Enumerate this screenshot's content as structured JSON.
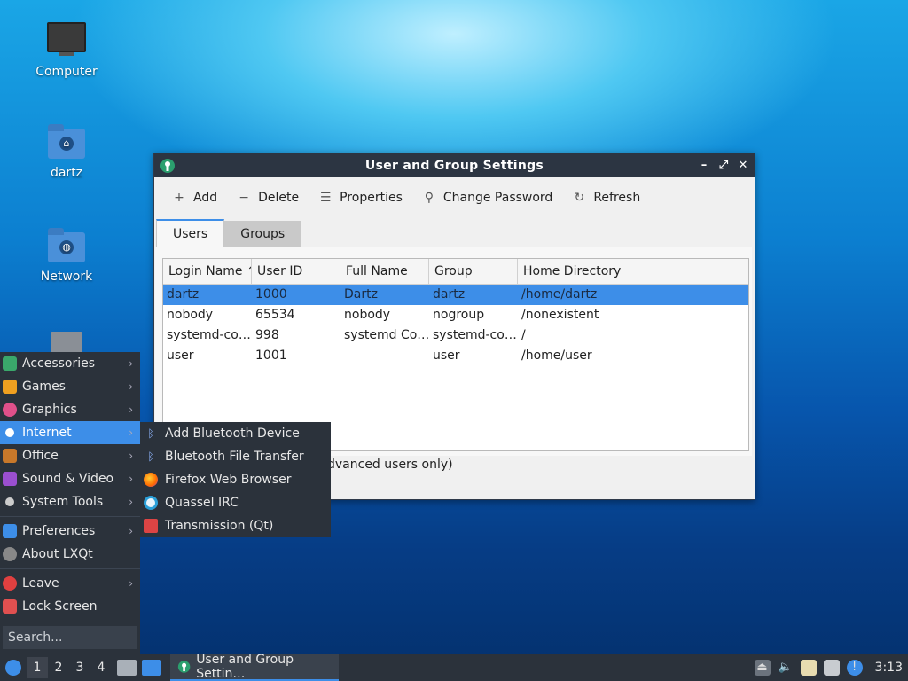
{
  "desktop": {
    "icons": [
      {
        "label": "Computer"
      },
      {
        "label": "dartz"
      },
      {
        "label": "Network"
      }
    ]
  },
  "window": {
    "title": "User and Group Settings",
    "controls": {
      "minimize": "–",
      "maximize": "⤢",
      "close": "✕"
    },
    "toolbar": {
      "add": "Add",
      "delete": "Delete",
      "properties": "Properties",
      "change_password": "Change Password",
      "refresh": "Refresh"
    },
    "tabs": [
      {
        "label": "Users"
      },
      {
        "label": "Groups"
      }
    ],
    "table": {
      "headers": [
        "Login Name",
        "User ID",
        "Full Name",
        "Group",
        "Home Directory"
      ],
      "rows": [
        [
          "dartz",
          "1000",
          "Dartz",
          "dartz",
          "/home/dartz"
        ],
        [
          "nobody",
          "65534",
          "nobody",
          "nogroup",
          "/nonexistent"
        ],
        [
          "systemd-co…",
          "998",
          "systemd Co…",
          "systemd-co…",
          "/"
        ],
        [
          "user",
          "1001",
          "",
          "user",
          "/home/user"
        ]
      ]
    },
    "note": "dvanced users only)"
  },
  "menu": {
    "items": [
      {
        "label": "Accessories",
        "color": "#3aa86b"
      },
      {
        "label": "Games",
        "color": "#f0a020"
      },
      {
        "label": "Graphics",
        "color": "#e0508a"
      },
      {
        "label": "Internet",
        "color": "#3d8ee8"
      },
      {
        "label": "Office",
        "color": "#c8782a"
      },
      {
        "label": "Sound & Video",
        "color": "#9b4fd0"
      },
      {
        "label": "System Tools",
        "color": "#cccccc"
      },
      {
        "label": "Preferences",
        "color": "#3d8ee8"
      },
      {
        "label": "About LXQt",
        "color": "#888888"
      },
      {
        "label": "Leave",
        "color": "#e04040"
      },
      {
        "label": "Lock Screen",
        "color": "#e05050"
      }
    ],
    "search_placeholder": "Search..."
  },
  "submenu": {
    "items": [
      {
        "label": "Add Bluetooth Device",
        "icon": "bluetooth-icon"
      },
      {
        "label": "Bluetooth File Transfer",
        "icon": "bluetooth-icon"
      },
      {
        "label": "Firefox Web Browser",
        "icon": "firefox-icon"
      },
      {
        "label": "Quassel IRC",
        "icon": "quassel-icon"
      },
      {
        "label": "Transmission (Qt)",
        "icon": "transmission-icon"
      }
    ]
  },
  "taskbar": {
    "workspaces": [
      "1",
      "2",
      "3",
      "4"
    ],
    "task_label": "User and Group Settin…",
    "clock": "3:13"
  },
  "colors": {
    "accent": "#3d8ee8",
    "panel": "#2b323b"
  }
}
